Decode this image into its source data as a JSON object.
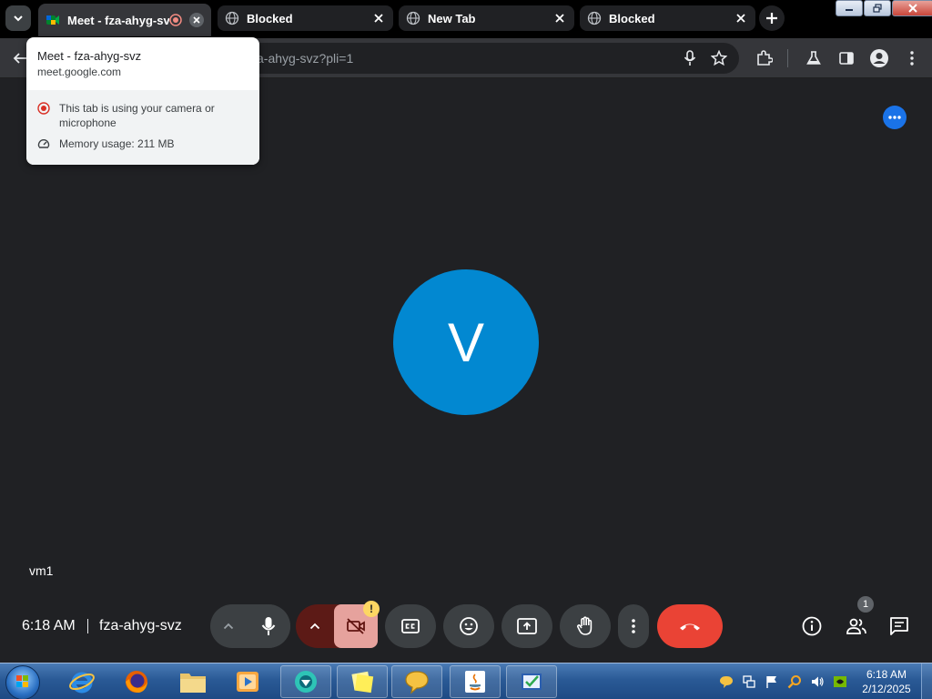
{
  "tabs": [
    {
      "title": "Meet - fza-ahyg-svz",
      "active": true,
      "recording": true
    },
    {
      "title": "Blocked",
      "active": false
    },
    {
      "title": "New Tab",
      "active": false
    },
    {
      "title": "Blocked",
      "active": false
    }
  ],
  "omnibox": {
    "url_fragment": "a-ahyg-svz?pli=1"
  },
  "hovercard": {
    "title": "Meet - fza-ahyg-svz",
    "domain": "meet.google.com",
    "camera_notice": "This tab is using your camera or microphone",
    "memory_usage": "Memory usage: 211 MB"
  },
  "meet": {
    "avatar_initial": "V",
    "participant_name": "vm1",
    "time": "6:18 AM",
    "meeting_code": "fza-ahyg-svz",
    "warning_badge": "!",
    "people_count": "1"
  },
  "colors": {
    "meet_background": "#202124",
    "avatar": "#0288d1",
    "end_call": "#ea4335",
    "camera_off": "#f28b82",
    "accent_blue": "#1a73e8"
  },
  "taskbar": {
    "time": "6:18 AM",
    "date": "2/12/2025"
  }
}
